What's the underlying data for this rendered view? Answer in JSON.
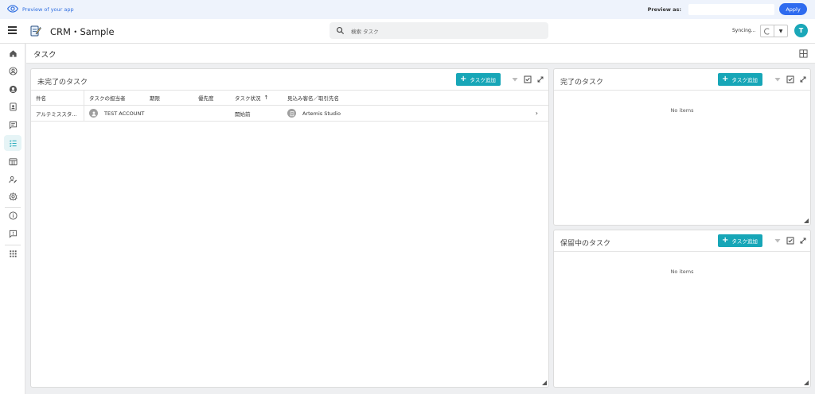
{
  "preview": {
    "link_label": "Preview of your app",
    "preview_as_label": "Preview as:",
    "preview_as_value": "",
    "apply_label": "Apply"
  },
  "header": {
    "app_title": "CRM・Sample",
    "search_placeholder": "検索 タスク",
    "sync_status": "Syncing...",
    "avatar_initial": "T"
  },
  "sidebar": {
    "items": [
      {
        "icon": "home-icon"
      },
      {
        "icon": "user-circle-outline-icon"
      },
      {
        "icon": "user-circle-filled-icon"
      },
      {
        "icon": "contact-card-icon"
      },
      {
        "icon": "comment-icon"
      },
      {
        "icon": "task-list-icon",
        "active": true
      },
      {
        "icon": "calendar-grid-icon"
      },
      {
        "icon": "user-edit-icon"
      },
      {
        "icon": "gear-icon"
      },
      {
        "icon": "info-icon"
      },
      {
        "icon": "feedback-icon"
      },
      {
        "icon": "apps-grid-icon"
      }
    ]
  },
  "page": {
    "title": "タスク"
  },
  "panels": {
    "incomplete": {
      "title": "未完了のタスク",
      "add_label": "タスク追加",
      "columns": [
        "件名",
        "タスクの担当者",
        "期限",
        "優先度",
        "タスク状況",
        "見込み客名／取引先名"
      ],
      "rows": [
        {
          "subject": "アルテミススタ...",
          "assignee": "TEST ACCOUNT",
          "due": "",
          "priority": "",
          "status": "開始前",
          "account": "Artemis Studio"
        }
      ]
    },
    "completed": {
      "title": "完了のタスク",
      "add_label": "タスク追加",
      "empty_text": "No items"
    },
    "on_hold": {
      "title": "保留中のタスク",
      "add_label": "タスク追加",
      "empty_text": "No items"
    }
  },
  "colors": {
    "accent": "#17a6b7",
    "apply_button": "#2e6bef",
    "preview_bar": "#eef3fc",
    "link": "#2f6ee0"
  }
}
